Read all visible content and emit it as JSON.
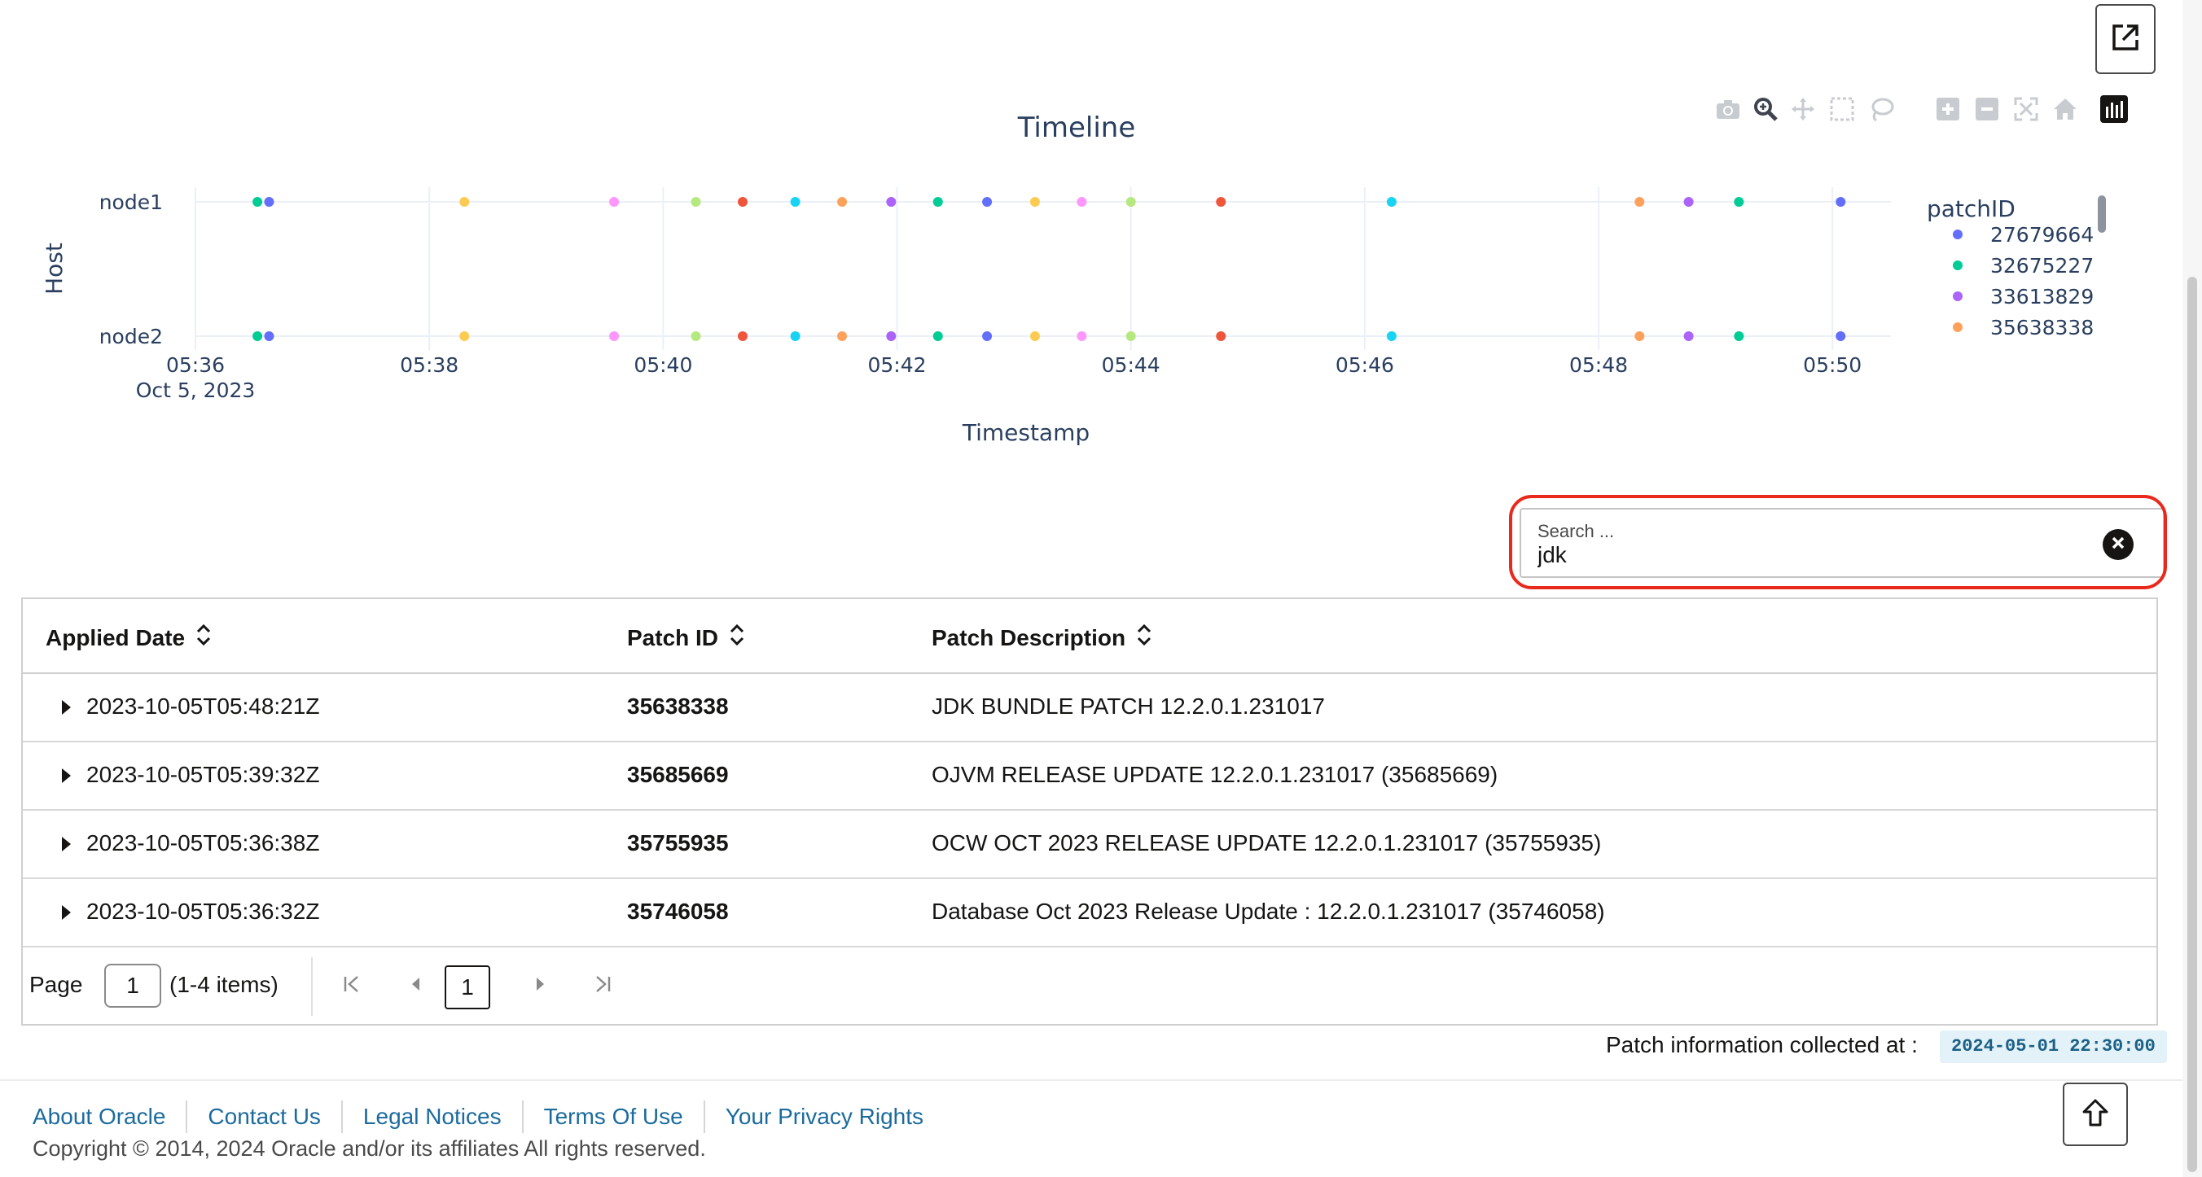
{
  "toolbar": {
    "external_link_icon": "external-link-icon",
    "modebar": [
      "camera-icon",
      "zoom-icon",
      "pan-icon",
      "box-select-icon",
      "lasso-icon",
      "zoom-in-icon",
      "zoom-out-icon",
      "autoscale-icon",
      "reset-axes-icon",
      "plotly-logo-icon"
    ]
  },
  "chart_data": {
    "type": "scatter",
    "title": "Timeline",
    "xlabel": "Timestamp",
    "ylabel": "Host",
    "categories": [
      "node1",
      "node2"
    ],
    "x_tick_labels": [
      "05:36",
      "05:38",
      "05:40",
      "05:42",
      "05:44",
      "05:46",
      "05:48",
      "05:50"
    ],
    "x_tick_date": "Oct 5, 2023",
    "x_tick_minutes": [
      36,
      38,
      40,
      42,
      44,
      46,
      48,
      50
    ],
    "xlim_minutes": [
      36.0,
      50.5
    ],
    "legend_title": "patchID",
    "legend_position": "right",
    "grid": true,
    "series": [
      {
        "name": "27679664",
        "color": "#636efa"
      },
      {
        "name": "32675227",
        "color": "#00cc96"
      },
      {
        "name": "33613829",
        "color": "#ab63fa"
      },
      {
        "name": "35638338",
        "color": "#ffa15a"
      }
    ],
    "points": [
      {
        "time": "05:36:32",
        "minute": 36.53,
        "color": "#00cc96"
      },
      {
        "time": "05:36:38",
        "minute": 36.63,
        "color": "#636efa"
      },
      {
        "time": "05:38:18",
        "minute": 38.3,
        "color": "#fecb52"
      },
      {
        "time": "05:39:35",
        "minute": 39.58,
        "color": "#ff97ff"
      },
      {
        "time": "05:40:17",
        "minute": 40.28,
        "color": "#b6e880"
      },
      {
        "time": "05:40:41",
        "minute": 40.68,
        "color": "#ef553b"
      },
      {
        "time": "05:41:08",
        "minute": 41.13,
        "color": "#19d3f3"
      },
      {
        "time": "05:41:32",
        "minute": 41.53,
        "color": "#ffa15a"
      },
      {
        "time": "05:41:57",
        "minute": 41.95,
        "color": "#ab63fa"
      },
      {
        "time": "05:42:21",
        "minute": 42.35,
        "color": "#00cc96"
      },
      {
        "time": "05:42:46",
        "minute": 42.77,
        "color": "#636efa"
      },
      {
        "time": "05:43:11",
        "minute": 43.18,
        "color": "#fecb52"
      },
      {
        "time": "05:43:35",
        "minute": 43.58,
        "color": "#ff97ff"
      },
      {
        "time": "05:44:00",
        "minute": 44.0,
        "color": "#b6e880"
      },
      {
        "time": "05:44:46",
        "minute": 44.77,
        "color": "#ef553b"
      },
      {
        "time": "05:46:14",
        "minute": 46.23,
        "color": "#19d3f3"
      },
      {
        "time": "05:48:21",
        "minute": 48.35,
        "color": "#ffa15a"
      },
      {
        "time": "05:48:46",
        "minute": 48.77,
        "color": "#ab63fa"
      },
      {
        "time": "05:49:12",
        "minute": 49.2,
        "color": "#00cc96"
      },
      {
        "time": "05:50:04",
        "minute": 50.07,
        "color": "#636efa"
      }
    ]
  },
  "search": {
    "label": "Search ...",
    "value": "jdk"
  },
  "table": {
    "headers": [
      "Applied Date",
      "Patch ID",
      "Patch Description"
    ],
    "rows": [
      {
        "date": "2023-10-05T05:48:21Z",
        "patch_id": "35638338",
        "description": "JDK BUNDLE PATCH 12.2.0.1.231017"
      },
      {
        "date": "2023-10-05T05:39:32Z",
        "patch_id": "35685669",
        "description": "OJVM RELEASE UPDATE 12.2.0.1.231017 (35685669)"
      },
      {
        "date": "2023-10-05T05:36:38Z",
        "patch_id": "35755935",
        "description": "OCW OCT 2023 RELEASE UPDATE 12.2.0.1.231017 (35755935)"
      },
      {
        "date": "2023-10-05T05:36:32Z",
        "patch_id": "35746058",
        "description": "Database Oct 2023 Release Update : 12.2.0.1.231017 (35746058)"
      }
    ]
  },
  "pagination": {
    "page_label": "Page",
    "page_value": "1",
    "range": "(1-4 items)",
    "current": "1"
  },
  "collected": {
    "label": "Patch information collected at :",
    "value": "2024-05-01 22:30:00"
  },
  "footer": {
    "links": [
      "About Oracle",
      "Contact Us",
      "Legal Notices",
      "Terms Of Use",
      "Your Privacy Rights"
    ],
    "copyright": "Copyright © 2014, 2024 Oracle and/or its affiliates All rights reserved."
  }
}
